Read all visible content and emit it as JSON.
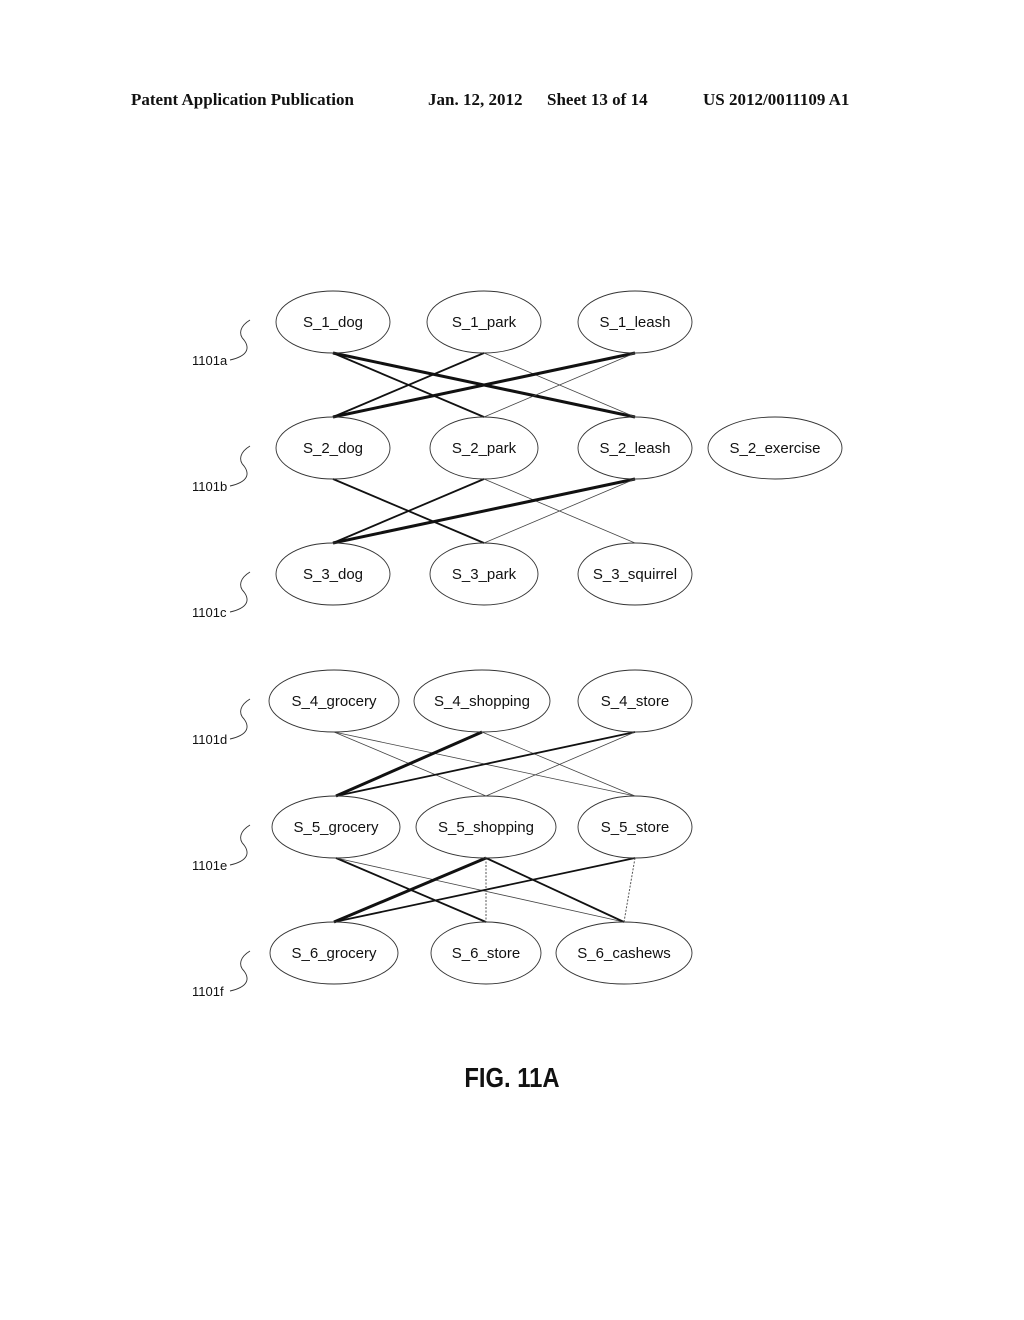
{
  "header": {
    "publication": "Patent Application Publication",
    "date": "Jan. 12, 2012",
    "sheet": "Sheet 13 of 14",
    "number": "US 2012/0011109 A1"
  },
  "figure": {
    "caption": "FIG. 11A",
    "rows": [
      {
        "ref": "1101a",
        "nodes": [
          "S_1_dog",
          "S_1_park",
          "S_1_leash"
        ]
      },
      {
        "ref": "1101b",
        "nodes": [
          "S_2_dog",
          "S_2_park",
          "S_2_leash",
          "S_2_exercise"
        ]
      },
      {
        "ref": "1101c",
        "nodes": [
          "S_3_dog",
          "S_3_park",
          "S_3_squirrel"
        ]
      },
      {
        "ref": "1101d",
        "nodes": [
          "S_4_grocery",
          "S_4_shopping",
          "S_4_store"
        ]
      },
      {
        "ref": "1101e",
        "nodes": [
          "S_5_grocery",
          "S_5_shopping",
          "S_5_store"
        ]
      },
      {
        "ref": "1101f",
        "nodes": [
          "S_6_grocery",
          "S_6_store",
          "S_6_cashews"
        ]
      }
    ],
    "edges": [
      {
        "from": "S_1_dog",
        "to": "S_2_leash",
        "weight": "heavy"
      },
      {
        "from": "S_1_dog",
        "to": "S_2_park",
        "weight": "medium"
      },
      {
        "from": "S_1_park",
        "to": "S_2_dog",
        "weight": "medium"
      },
      {
        "from": "S_1_park",
        "to": "S_2_leash",
        "weight": "light"
      },
      {
        "from": "S_1_leash",
        "to": "S_2_dog",
        "weight": "heavy"
      },
      {
        "from": "S_1_leash",
        "to": "S_2_park",
        "weight": "light"
      },
      {
        "from": "S_2_dog",
        "to": "S_3_park",
        "weight": "medium"
      },
      {
        "from": "S_2_park",
        "to": "S_3_dog",
        "weight": "medium"
      },
      {
        "from": "S_2_park",
        "to": "S_3_squirrel",
        "weight": "light"
      },
      {
        "from": "S_2_leash",
        "to": "S_3_dog",
        "weight": "heavy"
      },
      {
        "from": "S_2_leash",
        "to": "S_3_park",
        "weight": "light"
      },
      {
        "from": "S_4_grocery",
        "to": "S_5_shopping",
        "weight": "light"
      },
      {
        "from": "S_4_grocery",
        "to": "S_5_store",
        "weight": "light"
      },
      {
        "from": "S_4_shopping",
        "to": "S_5_grocery",
        "weight": "heavy"
      },
      {
        "from": "S_4_shopping",
        "to": "S_5_store",
        "weight": "light"
      },
      {
        "from": "S_4_store",
        "to": "S_5_grocery",
        "weight": "medium"
      },
      {
        "from": "S_4_store",
        "to": "S_5_shopping",
        "weight": "light"
      },
      {
        "from": "S_5_grocery",
        "to": "S_6_store",
        "weight": "medium"
      },
      {
        "from": "S_5_grocery",
        "to": "S_6_cashews",
        "weight": "light"
      },
      {
        "from": "S_5_shopping",
        "to": "S_6_grocery",
        "weight": "heavy"
      },
      {
        "from": "S_5_shopping",
        "to": "S_6_store",
        "weight": "dotted"
      },
      {
        "from": "S_5_shopping",
        "to": "S_6_cashews",
        "weight": "medium"
      },
      {
        "from": "S_5_store",
        "to": "S_6_grocery",
        "weight": "medium"
      },
      {
        "from": "S_5_store",
        "to": "S_6_cashews",
        "weight": "dotted"
      }
    ]
  }
}
